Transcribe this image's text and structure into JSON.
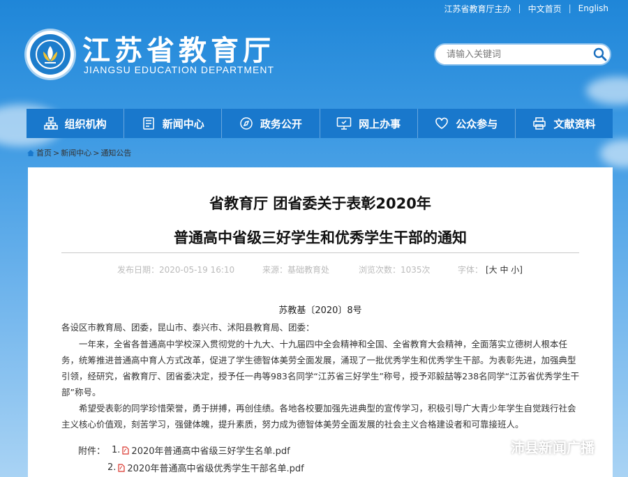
{
  "topbar": {
    "sponsor": "江苏省教育厅主办",
    "home": "中文首页",
    "english": "English"
  },
  "header": {
    "title_cn": "江苏省教育厅",
    "title_en": "JIANGSU EDUCATION DEPARTMENT"
  },
  "search": {
    "placeholder": "请输入关键词"
  },
  "nav": [
    {
      "label": "组织机构",
      "icon": "org-chart-icon"
    },
    {
      "label": "新闻中心",
      "icon": "document-icon"
    },
    {
      "label": "政务公开",
      "icon": "compass-icon"
    },
    {
      "label": "网上办事",
      "icon": "monitor-icon"
    },
    {
      "label": "公众参与",
      "icon": "heart-icon"
    },
    {
      "label": "文献资料",
      "icon": "printer-icon"
    }
  ],
  "breadcrumb": [
    "首页",
    "新闻中心",
    "通知公告"
  ],
  "article": {
    "title_line1": "省教育厅 团省委关于表彰2020年",
    "title_line2": "普通高中省级三好学生和优秀学生干部的通知",
    "meta": {
      "date": "发布日期：2020-05-19 16:10",
      "source": "来源：基础教育处",
      "views": "浏览次数：1035次",
      "font_label": "字体：",
      "font_sizes": "[大 中 小]"
    },
    "doc_no": "苏教基〔2020〕8号",
    "salutation": "各设区市教育局、团委，昆山市、泰兴市、沭阳县教育局、团委：",
    "para1": "一年来，全省各普通高中学校深入贯彻党的十九大、十九届四中全会精神和全国、全省教育大会精神，全面落实立德树人根本任务，统筹推进普通高中育人方式改革，促进了学生德智体美劳全面发展，涌现了一批优秀学生和优秀学生干部。为表彰先进，加强典型引领，经研究，省教育厅、团省委决定，授予任一冉等983名同学“江苏省三好学生”称号，授予邓毅喆等238名同学“江苏省优秀学生干部”称号。",
    "para2": "希望受表彰的同学珍惜荣誉，勇于拼搏，再创佳绩。各地各校要加强先进典型的宣传学习，积极引导广大青少年学生自觉践行社会主义核心价值观，刻苦学习，强健体魄，提升素质，努力成为德智体美劳全面发展的社会主义合格建设者和可靠接班人。",
    "attach_label": "附件：",
    "attachments": [
      {
        "no": "1.",
        "name": "2020年普通高中省级三好学生名单.pdf"
      },
      {
        "no": "2.",
        "name": "2020年普通高中省级优秀学生干部名单.pdf"
      }
    ]
  },
  "watermark": "沛县新闻广播",
  "colors": {
    "nav_bg": "#1978cc",
    "sky_top": "#1f86d8",
    "pdf_red": "#d9352c"
  }
}
